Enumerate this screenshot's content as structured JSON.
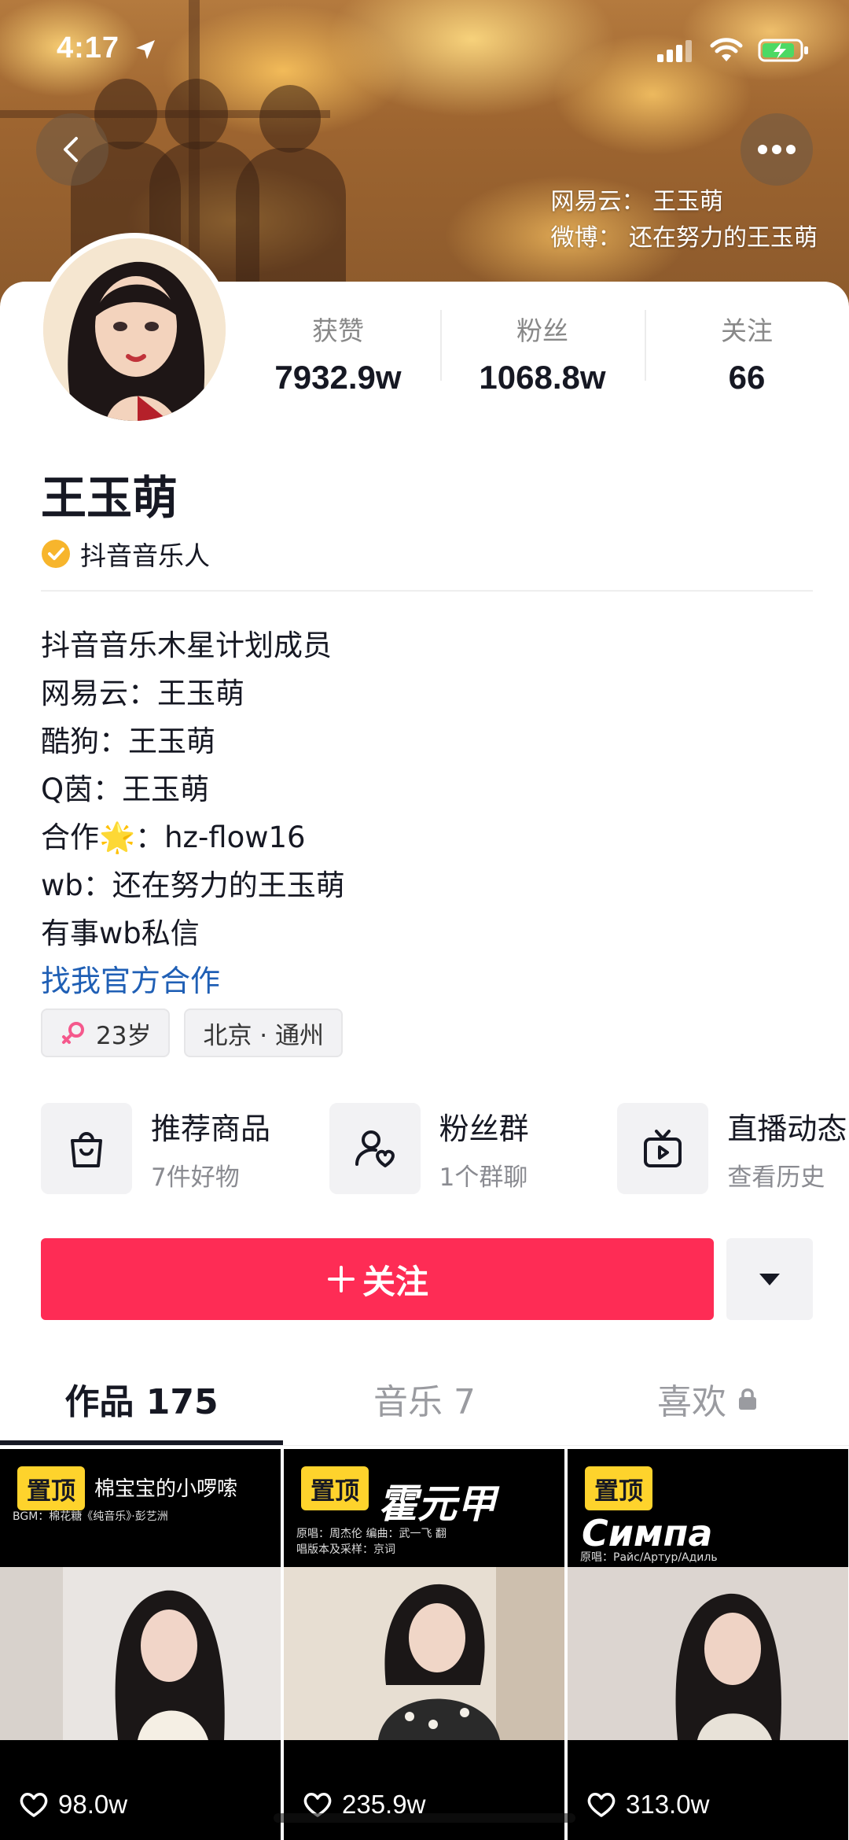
{
  "status_bar": {
    "time": "4:17"
  },
  "cover": {
    "caption_lines": [
      "网易云： 王玉萌",
      "微博： 还在努力的王玉萌"
    ]
  },
  "profile": {
    "stats": [
      {
        "label": "获赞",
        "value": "7932.9w"
      },
      {
        "label": "粉丝",
        "value": "1068.8w"
      },
      {
        "label": "关注",
        "value": "66"
      }
    ],
    "name": "王玉萌",
    "verification": "抖音音乐人",
    "bio_lines": [
      "抖音音乐木星计划成员",
      "网易云：王玉萌",
      "酷狗：王玉萌",
      "Q茵：王玉萌",
      "合作🌟：hz-flow16",
      "wb：还在努力的王玉萌",
      "有事wb私信"
    ],
    "bio_link": "找我官方合作",
    "tags": {
      "age": "23岁",
      "location": "北京 · 通州"
    }
  },
  "features": [
    {
      "icon": "shopping-bag-icon",
      "title": "推荐商品",
      "subtitle": "7件好物"
    },
    {
      "icon": "fan-group-icon",
      "title": "粉丝群",
      "subtitle": "1个群聊"
    },
    {
      "icon": "live-tv-icon",
      "title": "直播动态",
      "subtitle": "查看历史"
    }
  ],
  "actions": {
    "follow_label": "关注"
  },
  "tabs": [
    {
      "label": "作品 175",
      "active": true
    },
    {
      "label": "音乐 7",
      "active": false
    },
    {
      "label": "喜欢",
      "active": false,
      "locked": true
    }
  ],
  "videos": [
    {
      "pin": "置顶",
      "title": "棉宝宝的小啰嗦",
      "subtitle": "BGM：棉花糖《纯音乐》·彭艺洲",
      "likes": "98.0w"
    },
    {
      "pin": "置顶",
      "title": "霍元甲",
      "subtitle": "原唱：周杰伦  编曲：武一飞  翻唱版本及采样：京词",
      "likes": "235.9w"
    },
    {
      "pin": "置顶",
      "title": "Симпа",
      "subtitle": "原唱：Райс/Артур/Адиль",
      "likes": "313.0w"
    }
  ],
  "colors": {
    "accent": "#fe2c55",
    "pin": "#fed32c",
    "link": "#1f5fb5",
    "verify": "#f7b52c"
  }
}
